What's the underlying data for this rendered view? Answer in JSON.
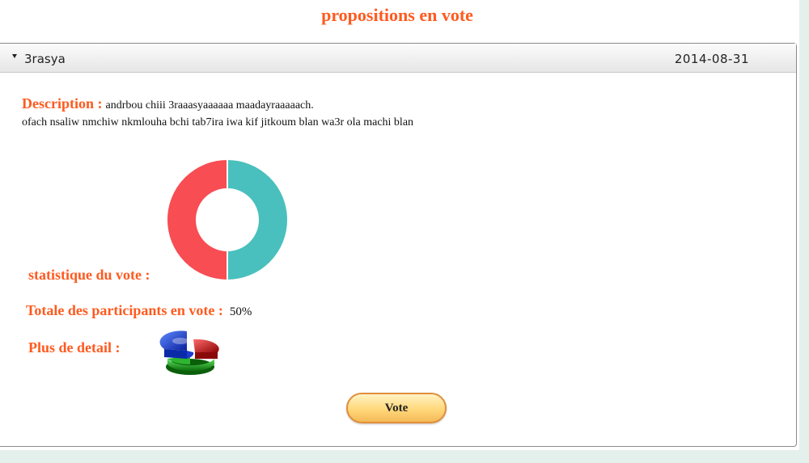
{
  "page": {
    "title": "propositions en vote"
  },
  "proposal": {
    "name": "3rasya",
    "date": "2014-08-31",
    "description_label": "Description :",
    "description_line1": "andrbou chiii 3raaasyaaaaaa maadayraaaaach.",
    "description_line2": "ofach nsaliw nmchiw nkmlouha bchi tab7ira iwa kif jitkoum blan wa3r ola machi blan",
    "stats_label": "statistique du vote :",
    "total_label": "Totale des participants en vote :",
    "total_value": "50%",
    "detail_label": "Plus de detail :",
    "vote_button": "Vote"
  },
  "colors": {
    "accent": "#ff5a1f",
    "donut_left": "#f74d53",
    "donut_right": "#49c0bd"
  },
  "icons": {
    "toggle": "caret-down-icon",
    "detail": "3d-pie-chart-icon"
  },
  "chart_data": {
    "type": "pie",
    "variant": "donut",
    "values": [
      50,
      50
    ],
    "colors": [
      "#49c0bd",
      "#f74d53"
    ]
  }
}
